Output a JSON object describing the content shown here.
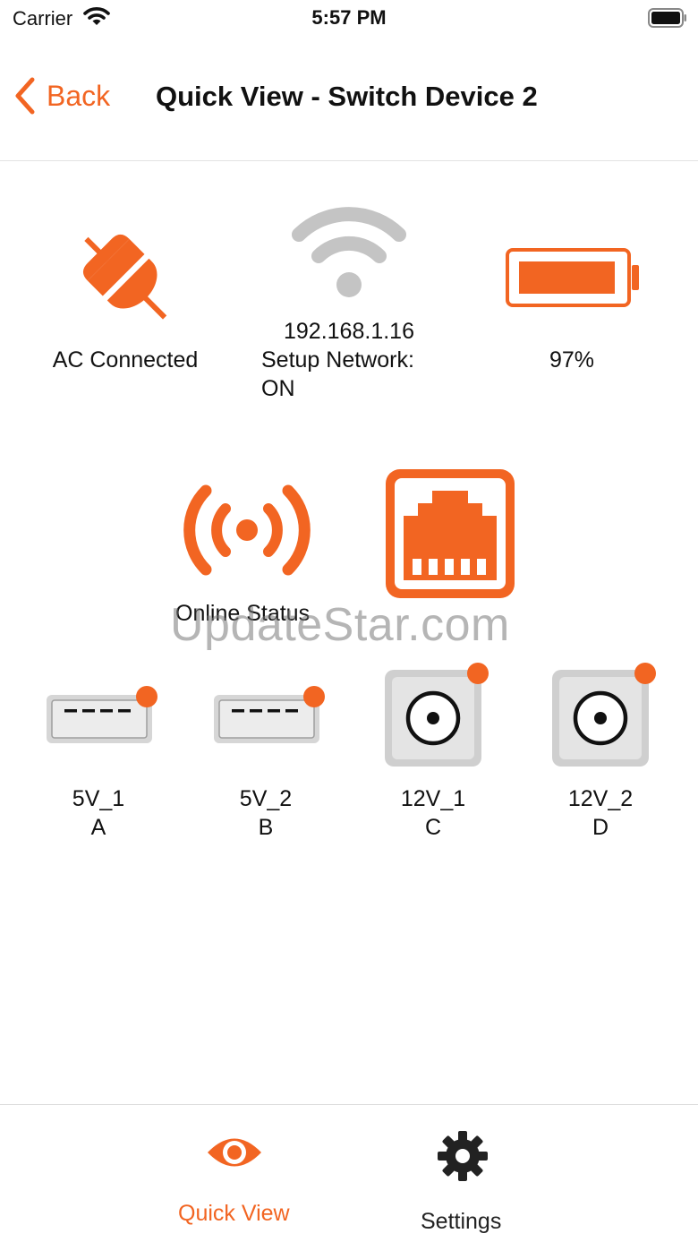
{
  "status_bar": {
    "carrier": "Carrier",
    "time": "5:57 PM"
  },
  "nav": {
    "back_label": "Back",
    "title": "Quick View - Switch Device 2"
  },
  "status_tiles": {
    "power": {
      "label": "AC Connected",
      "icon": "plug-icon"
    },
    "network": {
      "ip": "192.168.1.16",
      "setup_label": "Setup Network:",
      "setup_value": "ON",
      "icon": "wifi-icon"
    },
    "battery": {
      "label": "97%",
      "level": 0.97,
      "icon": "battery-icon"
    }
  },
  "online": {
    "label": "Online Status",
    "icon": "broadcast-icon",
    "ethernet_icon": "ethernet-icon"
  },
  "ports": [
    {
      "name": "5V_1",
      "letter": "A",
      "type": "usb"
    },
    {
      "name": "5V_2",
      "letter": "B",
      "type": "usb"
    },
    {
      "name": "12V_1",
      "letter": "C",
      "type": "dc"
    },
    {
      "name": "12V_2",
      "letter": "D",
      "type": "dc"
    }
  ],
  "watermark": "UpdateStar.com",
  "tabs": [
    {
      "label": "Quick View",
      "icon": "eye-icon",
      "active": true
    },
    {
      "label": "Settings",
      "icon": "gear-icon",
      "active": false
    }
  ],
  "colors": {
    "accent": "#f26522",
    "gray_icon": "#c4c4c4",
    "port_bg": "#d6d6d6"
  }
}
